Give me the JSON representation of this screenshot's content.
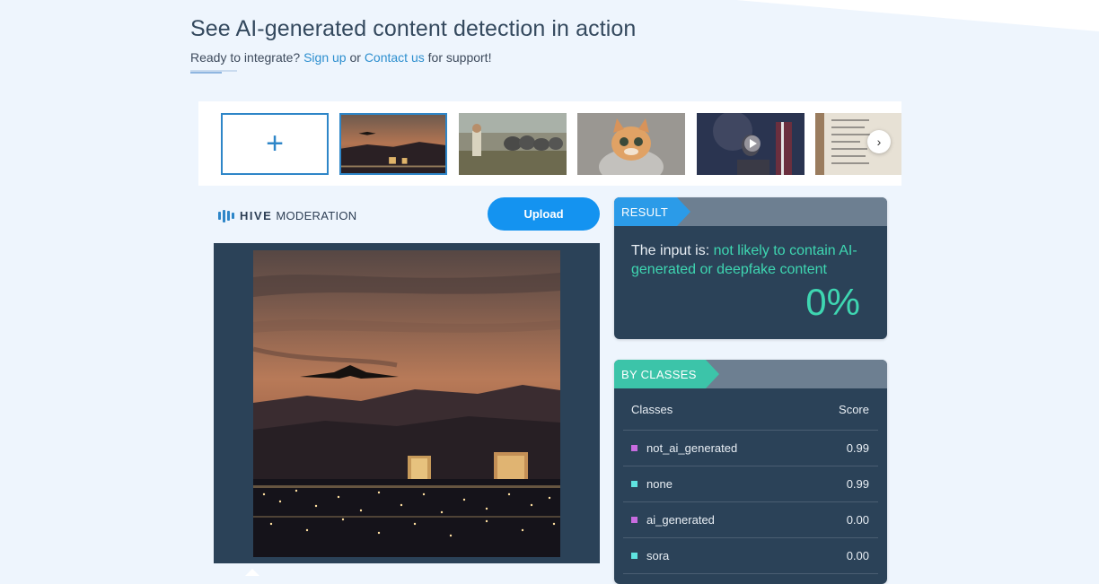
{
  "header": {
    "title": "See AI-generated content detection in action",
    "subtitle_prefix": "Ready to integrate?",
    "signup_link": "Sign up",
    "or_text": "or",
    "contact_link": "Contact us",
    "subtitle_suffix": "for support!"
  },
  "thumbnails": {
    "add_label": "+",
    "items": [
      {
        "name": "stealth-bomber-sunset",
        "selected": true
      },
      {
        "name": "elephants-painting",
        "selected": false
      },
      {
        "name": "cat-hoodie",
        "selected": false
      },
      {
        "name": "podium-speech",
        "selected": false
      },
      {
        "name": "handwritten-list",
        "selected": false
      }
    ],
    "next_icon": "chevron-right-icon"
  },
  "brand": {
    "bold": "HIVE",
    "light": "MODERATION"
  },
  "upload_label": "Upload",
  "result": {
    "tag": "RESULT",
    "prefix": "The input is:",
    "verdict": "not likely to contain AI-generated or deepfake content",
    "percent": "0%"
  },
  "classes": {
    "tag": "BY CLASSES",
    "header_classes": "Classes",
    "header_score": "Score",
    "rows": [
      {
        "name": "not_ai_generated",
        "score": "0.99",
        "color": "#c86ce0"
      },
      {
        "name": "none",
        "score": "0.99",
        "color": "#5fe3e0"
      },
      {
        "name": "ai_generated",
        "score": "0.00",
        "color": "#c86ce0"
      },
      {
        "name": "sora",
        "score": "0.00",
        "color": "#5fe3e0"
      }
    ]
  },
  "colors": {
    "accent": "#1493f0",
    "teal": "#3ed6b1",
    "panel": "#2b4258"
  }
}
